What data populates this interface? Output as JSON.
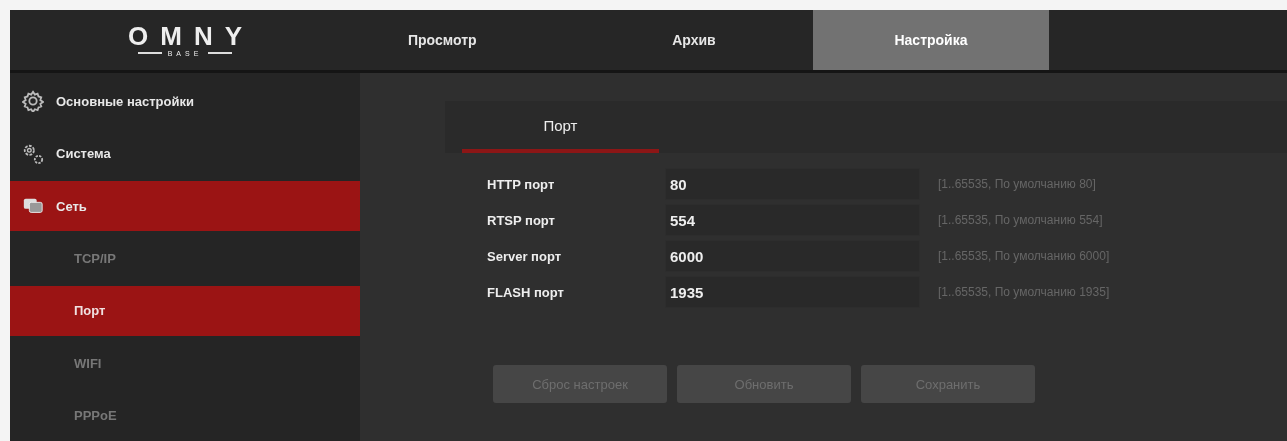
{
  "logo": {
    "name": "OMNY",
    "sub": "BASE"
  },
  "top_tabs": [
    {
      "label": "Просмотр",
      "selected": false
    },
    {
      "label": "Архив",
      "selected": false
    },
    {
      "label": "Настройка",
      "selected": true
    }
  ],
  "sidebar": {
    "items": [
      {
        "label": "Основные настройки",
        "selected": false,
        "expanded": false
      },
      {
        "label": "Система",
        "selected": false,
        "expanded": false
      },
      {
        "label": "Сеть",
        "selected": true,
        "expanded": true,
        "children": [
          {
            "label": "TCP/IP",
            "selected": false
          },
          {
            "label": "Порт",
            "selected": true
          },
          {
            "label": "WIFI",
            "selected": false
          },
          {
            "label": "PPPoE",
            "selected": false
          }
        ]
      }
    ]
  },
  "content": {
    "tabs": [
      {
        "label": "Порт",
        "selected": true
      }
    ],
    "fields": [
      {
        "label": "HTTP порт",
        "value": "80",
        "hint": "[1..65535, По умолчанию 80]"
      },
      {
        "label": "RTSP порт",
        "value": "554",
        "hint": "[1..65535, По умолчанию 554]"
      },
      {
        "label": "Server порт",
        "value": "6000",
        "hint": "[1..65535, По умолчанию 6000]"
      },
      {
        "label": "FLASH порт",
        "value": "1935",
        "hint": "[1..65535, По умолчанию 1935]"
      }
    ],
    "buttons": [
      {
        "label": "Сброс настроек",
        "disabled": true
      },
      {
        "label": "Обновить",
        "disabled": true
      },
      {
        "label": "Сохранить",
        "disabled": true
      }
    ]
  }
}
